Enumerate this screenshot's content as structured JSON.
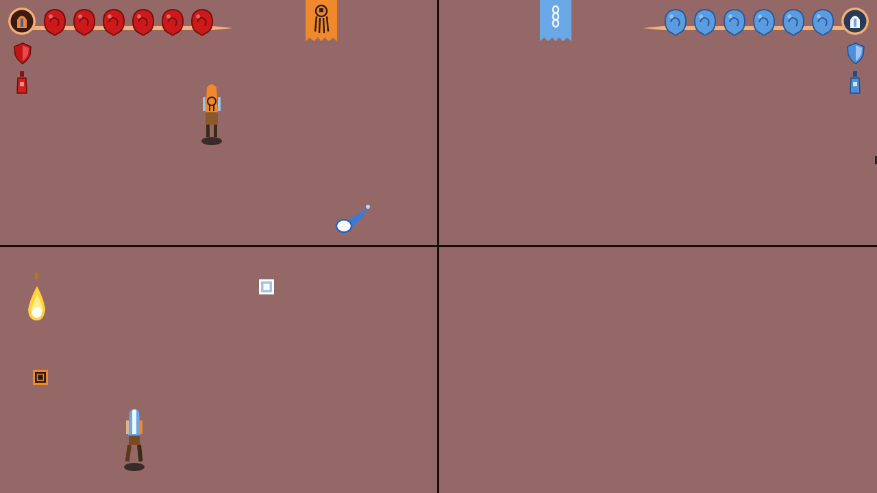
{
  "screen": {
    "background": "#946866",
    "divider_color": "#111111"
  },
  "players": [
    {
      "id": "orange-player",
      "team_color": "#f0892c",
      "orb_color": "#cc1a1a",
      "health_orbs": 6,
      "shield_color": "#d11f1f",
      "potion_color": "#d11f1f",
      "banner_color": "#f0892c",
      "banner_icon": "squid-icon",
      "avatar_icon": "hooded-figure-icon"
    },
    {
      "id": "blue-player",
      "team_color": "#6aa8e8",
      "orb_color": "#5b9ce0",
      "health_orbs": 6,
      "shield_color": "#4e8fdc",
      "potion_color": "#4e8fdc",
      "banner_color": "#6aa8e8",
      "banner_icon": "chain-icon",
      "avatar_icon": "hooded-figure-icon"
    }
  ],
  "pickups": [
    {
      "type": "square-pickup",
      "color": "#ffffff"
    },
    {
      "type": "square-pickup",
      "color": "#f0892c"
    }
  ],
  "projectiles": [
    {
      "type": "ice-bolt",
      "color": "#ffffff"
    },
    {
      "type": "fireball",
      "color": "#ffd23a"
    }
  ]
}
